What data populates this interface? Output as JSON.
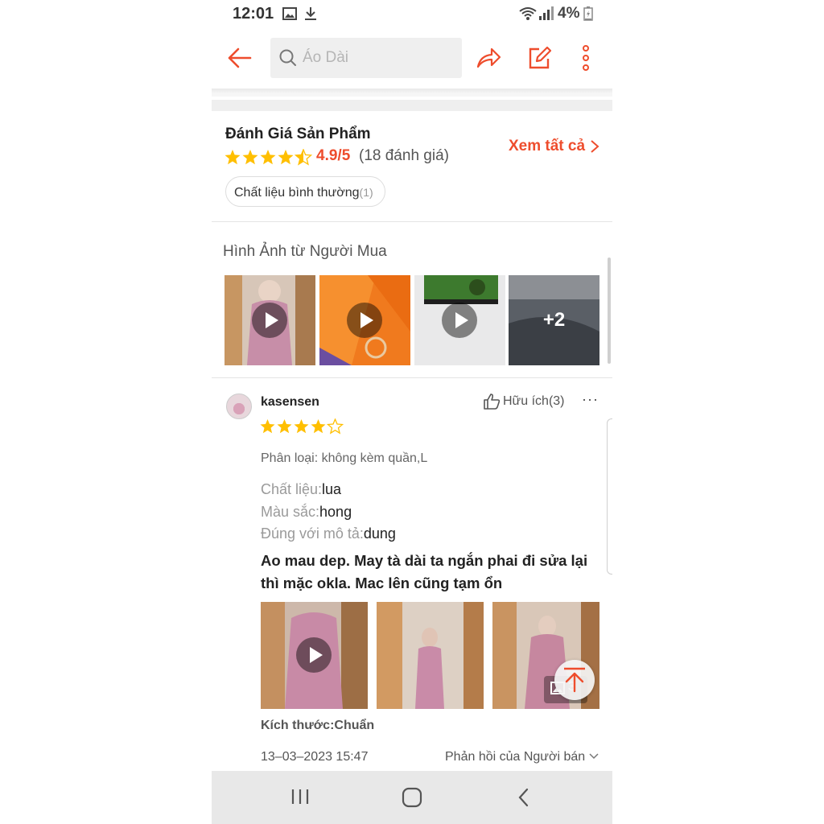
{
  "status_bar": {
    "time": "12:01",
    "battery": "4%"
  },
  "header": {
    "search_placeholder": "Áo Dài"
  },
  "ratings": {
    "title": "Đánh Giá Sản Phẩm",
    "score": "4.9/5",
    "count": "(18 đánh giá)",
    "see_all": "Xem tất cả",
    "chip_label": "Chất liệu bình thường",
    "chip_count": "(1)",
    "stars_value": 4.5
  },
  "buyer_images": {
    "title": "Hình Ảnh từ Người Mua",
    "more_label": "+2"
  },
  "review": {
    "username": "kasensen",
    "helpful": "Hữu ích(3)",
    "more": "···",
    "stars_value": 4,
    "variant": "Phân loại: không kèm quần,L",
    "attributes": [
      {
        "key": "Chất liệu:",
        "value": "lua"
      },
      {
        "key": "Màu sắc:",
        "value": "hong"
      },
      {
        "key": "Đúng với mô tả:",
        "value": "dung"
      }
    ],
    "comment": "Ao mau dep. May tà dài ta ngắn phai đi sửa lại thì mặc okla. Mac lên cũng tạm ổn",
    "image_count": "3",
    "size": "Kích thước:Chuẩn",
    "date": "13–03–2023 15:47",
    "seller_reply": "Phản hồi của Người bán"
  },
  "colors": {
    "accent": "#ee4d2d",
    "star": "#ffbf00"
  }
}
